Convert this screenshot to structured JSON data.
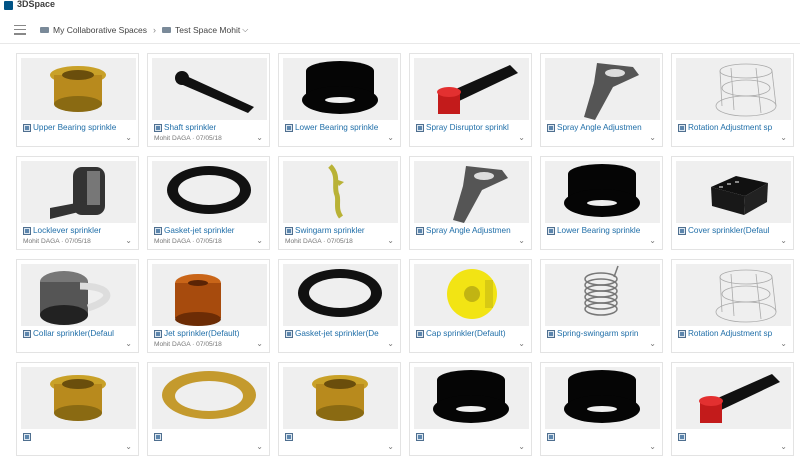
{
  "app": {
    "title": "3DSpace"
  },
  "breadcrumb": {
    "space": "My Collaborative Spaces",
    "current": "Test Space Mohit"
  },
  "cards": [
    {
      "title": "Upper Bearing sprinkle",
      "owner": "",
      "date": "",
      "shape": "bearing-gold"
    },
    {
      "title": "Shaft sprinkler",
      "owner": "Mohit DAGA",
      "date": "07/05/18",
      "shape": "shaft"
    },
    {
      "title": "Lower Bearing sprinkle",
      "owner": "",
      "date": "",
      "shape": "black-bell"
    },
    {
      "title": "Spray Disruptor sprinkl",
      "owner": "",
      "date": "",
      "shape": "disruptor"
    },
    {
      "title": "Spray Angle Adjustmen",
      "owner": "",
      "date": "",
      "shape": "angle"
    },
    {
      "title": "Rotation Adjustment sp",
      "owner": "",
      "date": "",
      "shape": "wire"
    },
    {
      "title": "Locklever sprinkler",
      "owner": "Mohit DAGA",
      "date": "07/05/18",
      "shape": "locklever"
    },
    {
      "title": "Gasket-jet sprinkler",
      "owner": "Mohit DAGA",
      "date": "07/05/18",
      "shape": "ring-black"
    },
    {
      "title": "Swingarm sprinkler",
      "owner": "Mohit DAGA",
      "date": "07/05/18",
      "shape": "swingarm"
    },
    {
      "title": "Spray Angle Adjustmen",
      "owner": "",
      "date": "",
      "shape": "angle"
    },
    {
      "title": "Lower Bearing sprinkle",
      "owner": "",
      "date": "",
      "shape": "black-bell"
    },
    {
      "title": "Cover sprinkler(Defaul",
      "owner": "",
      "date": "",
      "shape": "cover"
    },
    {
      "title": "Collar sprinkler(Defaul",
      "owner": "",
      "date": "",
      "shape": "collar"
    },
    {
      "title": "Jet sprinkler(Default)",
      "owner": "Mohit DAGA",
      "date": "07/05/18",
      "shape": "jet"
    },
    {
      "title": "Gasket-jet sprinkler(De",
      "owner": "",
      "date": "",
      "shape": "ring-black"
    },
    {
      "title": "Cap sprinkler(Default)",
      "owner": "",
      "date": "",
      "shape": "cap"
    },
    {
      "title": "Spring-swingarm sprin",
      "owner": "",
      "date": "",
      "shape": "spring"
    },
    {
      "title": "Rotation Adjustment sp",
      "owner": "",
      "date": "",
      "shape": "wire"
    },
    {
      "title": "",
      "owner": "",
      "date": "",
      "shape": "bearing-gold"
    },
    {
      "title": "",
      "owner": "",
      "date": "",
      "shape": "ring-gold"
    },
    {
      "title": "",
      "owner": "",
      "date": "",
      "shape": "bearing-gold"
    },
    {
      "title": "",
      "owner": "",
      "date": "",
      "shape": "black-bell"
    },
    {
      "title": "",
      "owner": "",
      "date": "",
      "shape": "black-bell"
    },
    {
      "title": "",
      "owner": "",
      "date": "",
      "shape": "disruptor"
    }
  ]
}
